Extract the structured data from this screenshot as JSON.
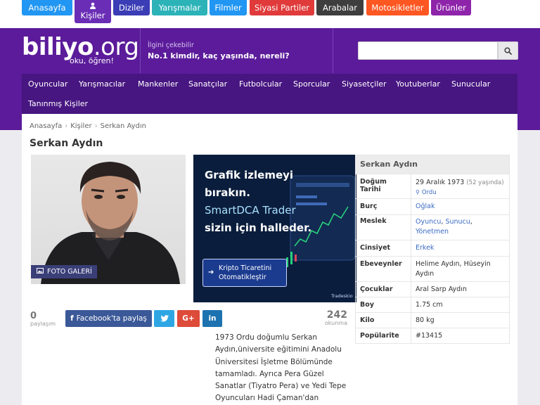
{
  "top_categories": [
    {
      "label": "Anasayfa",
      "color": "#2196f3"
    },
    {
      "label": "Kişiler",
      "color": "#6a2db5"
    },
    {
      "label": "Diziler",
      "color": "#3a3db5"
    },
    {
      "label": "Yarışmalar",
      "color": "#2bb3b8"
    },
    {
      "label": "Filmler",
      "color": "#2196f3"
    },
    {
      "label": "Siyasi Partiler",
      "color": "#e03a3a"
    },
    {
      "label": "Arabalar",
      "color": "#3e3e3e"
    },
    {
      "label": "Motosikletler",
      "color": "#ff5722"
    },
    {
      "label": "Ürünler",
      "color": "#8e24aa"
    }
  ],
  "header": {
    "logo_main": "biliyo",
    "logo_tld": ".org",
    "tagline": "oku, öğren!",
    "promo_small": "İlgini çekebilir",
    "promo_big": "No.1 kimdir, kaç yaşında, nereli?",
    "search_placeholder": ""
  },
  "main_nav": [
    "Oyuncular",
    "Yarışmacılar",
    "Mankenler",
    "Sanatçılar",
    "Futbolcular",
    "Sporcular",
    "Siyasetçiler",
    "Youtuberlar",
    "Sunucular",
    "Tanınmış Kişiler"
  ],
  "breadcrumb": [
    "Anasayfa",
    "Kişiler",
    "Serkan Aydın"
  ],
  "page_title": "Serkan Aydın",
  "gallery_label": "FOTO GALERİ",
  "ad": {
    "line1": "Grafik izlemeyi",
    "line2": "bırakın.",
    "line3": "SmartDCA Trader",
    "line4": "sizin için halleder.",
    "cta1": "Kripto Ticaretini",
    "cta2": "Otomatikleştir",
    "brand": "Tradeskio"
  },
  "info": {
    "name": "Serkan Aydın",
    "rows": {
      "dogum_label": "Doğum Tarihi",
      "dogum_date": "29 Aralık 1973",
      "dogum_age": "(52 yaşında)",
      "dogum_place": "Ordu",
      "burc_label": "Burç",
      "burc": "Oğlak",
      "meslek_label": "Meslek",
      "meslek_1": "Oyuncu",
      "meslek_2": "Sunucu",
      "meslek_3": "Yönetmen",
      "cinsiyet_label": "Cinsiyet",
      "cinsiyet": "Erkek",
      "ebeveyn_label": "Ebeveynler",
      "ebeveyn": "Helime Aydın, Hüseyin Aydın",
      "cocuk_label": "Çocuklar",
      "cocuk": "Aral Sarp Aydın",
      "boy_label": "Boy",
      "boy": "1.75 cm",
      "kilo_label": "Kilo",
      "kilo": "80 kg",
      "pop_label": "Popülarite",
      "pop": "#13415"
    }
  },
  "share": {
    "count": "0",
    "count_label": "paylaşım",
    "facebook": "Facebook'ta paylaş",
    "twitter": "",
    "google": "G+",
    "linkedin": "in",
    "reads": "242",
    "reads_label": "okunma",
    "colors": {
      "facebook": "#3b5998",
      "twitter": "#2ea6e4",
      "google": "#dd4b39",
      "linkedin": "#1d73b0"
    }
  },
  "bio": "1973 Ordu doğumlu Serkan Aydın,üniversite eğitimini Anadolu Üniversitesi İşletme Bölümünde tamamladı. Ayrıca Pera Güzel Sanatlar (Tiyatro Pera) ve Yedi Tepe Oyuncuları Hadi Çaman'dan"
}
